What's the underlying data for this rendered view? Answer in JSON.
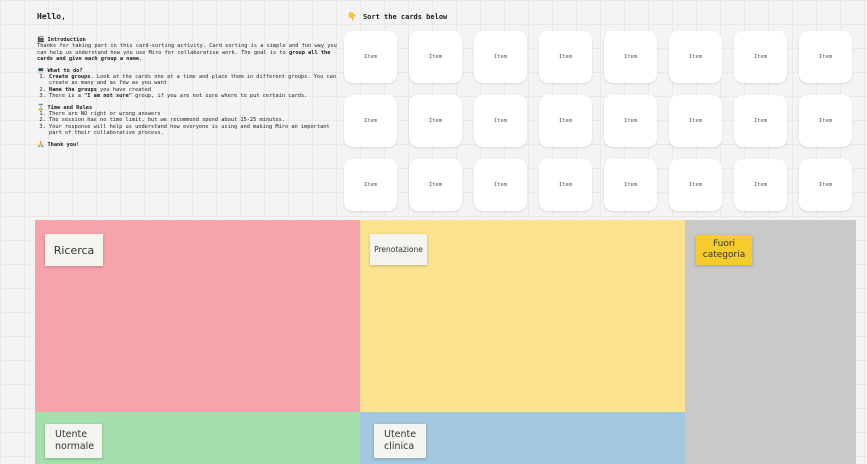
{
  "instructions": {
    "greeting": "Hello,",
    "intro_title": "Introduction",
    "intro_text_pre": "Thanks for taking part in this card-sorting activity. Card sorting is a simple and fun way you can help us understand how you use Miro for collaborative work. The goal is to ",
    "intro_text_bold": "group all the cards and give each group a name",
    "intro_text_post": ".",
    "what_title": "What to do?",
    "steps": [
      {
        "bold": "Create groups",
        "text": ". Look at the cards one at a time and place them in different groups. You can create as many and as few as you want"
      },
      {
        "bold": "Name the groups",
        "text": " you have created"
      },
      {
        "pre": "There is a ",
        "bold": "\"I am not sure\"",
        "text": " group, if you are not sure where to put certain cards."
      }
    ],
    "rules_title": "Time and Rules",
    "rules": [
      "There are NO right or wrong answers",
      "The session has no time limit, but we recommend spend about 15-25 minutes.",
      "Your response will help us understand how everyone is using and making Miro an important part of their collaborative process."
    ],
    "thanks": "Thank you!"
  },
  "sort_header": "Sort the cards below",
  "cards": [
    "Item",
    "Item",
    "Item",
    "Item",
    "Item",
    "Item",
    "Item",
    "Item",
    "Item",
    "Item",
    "Item",
    "Item",
    "Item",
    "Item",
    "Item",
    "Item",
    "Item",
    "Item",
    "Item",
    "Item",
    "Item",
    "Item",
    "Item",
    "Item"
  ],
  "groups": {
    "ricerca": "Ricerca",
    "prenotazione": "Prenotazione",
    "fuori": "Fuori categoria",
    "utente_normale": "Utente normale",
    "utente_clinica": "Utente clinica"
  },
  "colors": {
    "ricerca": "#f7a3ab",
    "prenotazione": "#fde38e",
    "fuori": "#c9c9c9",
    "utente_normale": "#a3e0ad",
    "utente_clinica": "#a2c9df",
    "fuori_sticky": "#f6cb2c"
  }
}
